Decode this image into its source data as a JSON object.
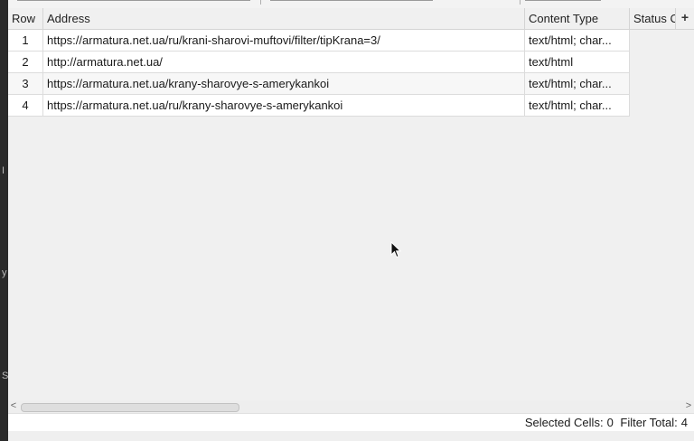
{
  "grid": {
    "columns": [
      "Row",
      "Address",
      "Content Type",
      "Status C"
    ],
    "rows": [
      {
        "row": "1",
        "address": "https://armatura.net.ua/ru/krani-sharovi-muftovi/filter/tipKrana=3/",
        "content_type": "text/html; char...",
        "status": ""
      },
      {
        "row": "2",
        "address": "http://armatura.net.ua/",
        "content_type": "text/html",
        "status": ""
      },
      {
        "row": "3",
        "address": "https://armatura.net.ua/krany-sharovye-s-amerykankoi",
        "content_type": "text/html; char...",
        "status": ""
      },
      {
        "row": "4",
        "address": "https://armatura.net.ua/ru/krany-sharovye-s-amerykankoi",
        "content_type": "text/html; char...",
        "status": ""
      }
    ],
    "add_column_symbol": "+"
  },
  "scrollbar": {
    "left_arrow": "<",
    "right_arrow": ">"
  },
  "status_bar": {
    "selected_cells_label": "Selected Cells:",
    "selected_cells_value": "0",
    "filter_total_label": "Filter Total:",
    "filter_total_value": "4"
  },
  "left_panel": {
    "fragments": [
      "I",
      "y",
      "S"
    ]
  }
}
